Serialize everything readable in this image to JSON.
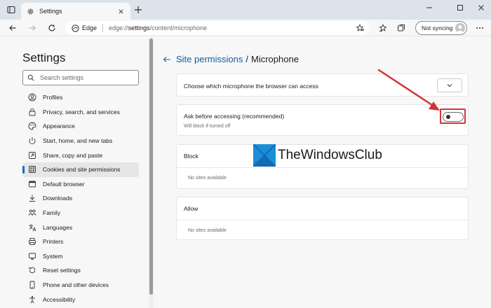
{
  "browser": {
    "tab_title": "Settings",
    "address_label": "Edge",
    "url_prefix": "edge://",
    "url_bold": "settings",
    "url_rest": "/content/microphone",
    "sync_label": "Not syncing"
  },
  "sidebar": {
    "title": "Settings",
    "search_placeholder": "Search settings",
    "items": [
      {
        "label": "Profiles",
        "icon": "profile-icon"
      },
      {
        "label": "Privacy, search, and services",
        "icon": "lock-icon"
      },
      {
        "label": "Appearance",
        "icon": "palette-icon"
      },
      {
        "label": "Start, home, and new tabs",
        "icon": "power-icon"
      },
      {
        "label": "Share, copy and paste",
        "icon": "share-icon"
      },
      {
        "label": "Cookies and site permissions",
        "icon": "cookies-icon",
        "active": true
      },
      {
        "label": "Default browser",
        "icon": "browser-icon"
      },
      {
        "label": "Downloads",
        "icon": "download-icon"
      },
      {
        "label": "Family",
        "icon": "family-icon"
      },
      {
        "label": "Languages",
        "icon": "language-icon"
      },
      {
        "label": "Printers",
        "icon": "printer-icon"
      },
      {
        "label": "System",
        "icon": "system-icon"
      },
      {
        "label": "Reset settings",
        "icon": "reset-icon"
      },
      {
        "label": "Phone and other devices",
        "icon": "phone-icon"
      },
      {
        "label": "Accessibility",
        "icon": "accessibility-icon"
      }
    ]
  },
  "main": {
    "breadcrumb_link": "Site permissions",
    "breadcrumb_sep": "/",
    "breadcrumb_current": "Microphone",
    "choose_label": "Choose which microphone the browser can access",
    "ask": {
      "title": "Ask before accessing (recommended)",
      "subtitle": "Will block if turned off",
      "enabled": false
    },
    "block": {
      "title": "Block",
      "empty": "No sites available"
    },
    "allow": {
      "title": "Allow",
      "empty": "No sites available"
    }
  },
  "watermark": {
    "text": "TheWindowsClub"
  },
  "colors": {
    "accent": "#0f6cbd",
    "link": "#115ea3",
    "highlight": "#d13438"
  }
}
